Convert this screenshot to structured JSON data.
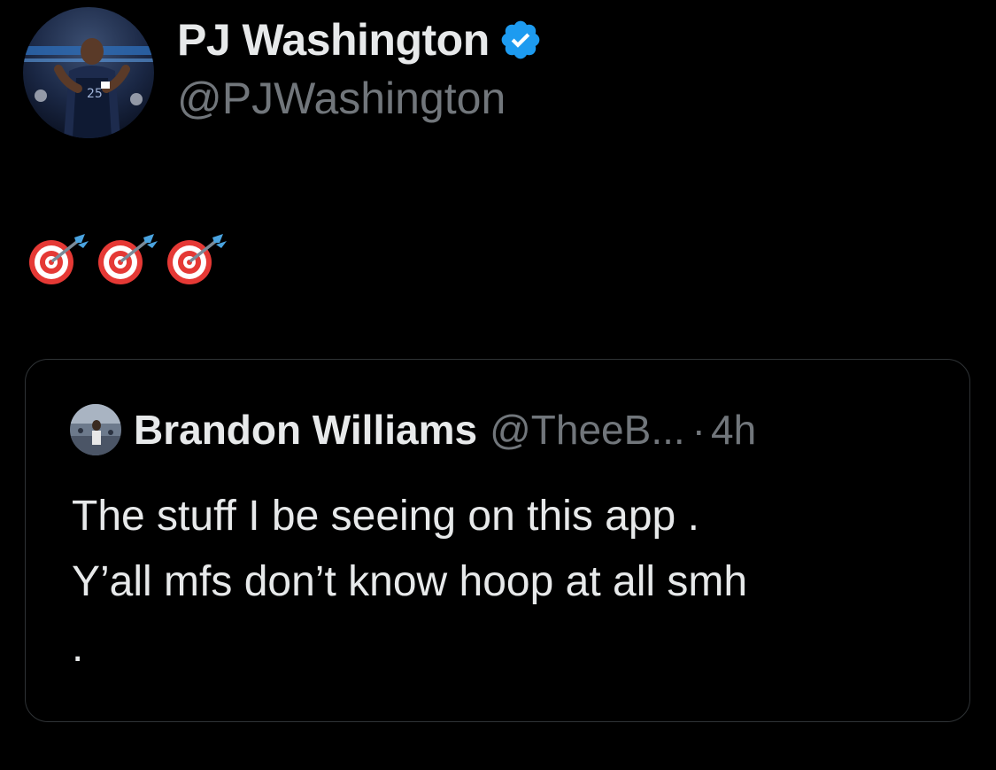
{
  "author": {
    "display_name": "PJ Washington",
    "handle": "@PJWashington",
    "verified": true,
    "verified_color": "#1d9bf0",
    "avatar_icon": "avatar-photo"
  },
  "tweet": {
    "emojis": [
      "direct-hit-target-icon",
      "direct-hit-target-icon",
      "direct-hit-target-icon"
    ]
  },
  "quoted_tweet": {
    "display_name": "Brandon Williams",
    "handle": "@TheeB...",
    "separator": "·",
    "time": "4h",
    "lines": [
      "The stuff I be seeing on this app .",
      "Y’all mfs don’t know hoop at all smh",
      "."
    ]
  },
  "colors": {
    "background": "#000000",
    "primary_text": "#e7e9ea",
    "secondary_text": "#71767b",
    "border": "#2f3336"
  }
}
